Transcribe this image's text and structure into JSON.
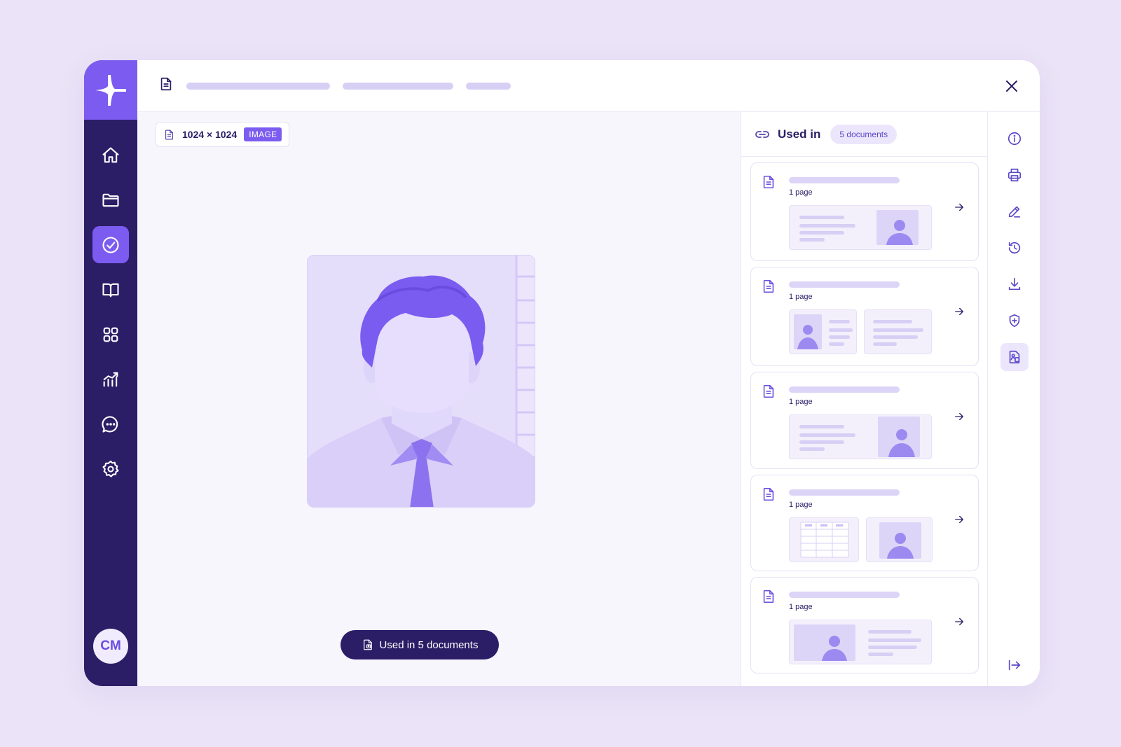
{
  "sidebar": {
    "logo": "spark-logo",
    "items": [
      {
        "name": "home-icon",
        "active": false
      },
      {
        "name": "folder-icon",
        "active": false
      },
      {
        "name": "check-circle-icon",
        "active": true
      },
      {
        "name": "book-icon",
        "active": false
      },
      {
        "name": "apps-grid-icon",
        "active": false
      },
      {
        "name": "analytics-icon",
        "active": false
      },
      {
        "name": "chat-icon",
        "active": false
      },
      {
        "name": "settings-icon",
        "active": false
      }
    ],
    "user_initials": "CM"
  },
  "header": {
    "icon": "document-icon",
    "close_icon": "close-icon"
  },
  "viewer": {
    "dimensions": "1024 × 1024",
    "type_badge": "IMAGE",
    "used_in_button": "Used in 5 documents"
  },
  "used_in_panel": {
    "title": "Used in",
    "count": "5 documents",
    "documents": [
      {
        "pages": "1 page"
      },
      {
        "pages": "1 page"
      },
      {
        "pages": "1 page"
      },
      {
        "pages": "1 page"
      },
      {
        "pages": "1 page"
      }
    ]
  },
  "tools": [
    "info-icon",
    "print-icon",
    "edit-icon",
    "history-icon",
    "download-icon",
    "shield-icon",
    "document-image-icon",
    "collapse-panel-icon"
  ],
  "colors": {
    "background": "#ebe3f7",
    "sidebar": "#2b1d66",
    "accent": "#7c5cf0",
    "text": "#2b1d66"
  }
}
